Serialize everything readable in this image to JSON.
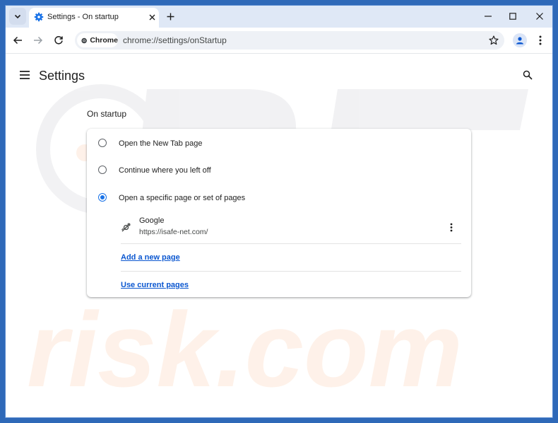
{
  "tab": {
    "title": "Settings - On startup",
    "close_icon": "close-icon",
    "new_tab_icon": "plus-icon"
  },
  "toolbar": {
    "chip_label": "Chrome",
    "url": "chrome://settings/onStartup"
  },
  "settings": {
    "title": "Settings",
    "section_title": "On startup",
    "options": [
      {
        "label": "Open the New Tab page",
        "checked": false
      },
      {
        "label": "Continue where you left off",
        "checked": false
      },
      {
        "label": "Open a specific page or set of pages",
        "checked": true
      }
    ],
    "startup_page": {
      "name": "Google",
      "url": "https://isafe-net.com/"
    },
    "add_page_label": "Add a new page",
    "use_current_label": "Use current pages"
  },
  "colors": {
    "accent": "#1a73e8",
    "link": "#0b57d0",
    "tabstrip": "#dfe8f6",
    "desktop": "#2f69b8"
  }
}
